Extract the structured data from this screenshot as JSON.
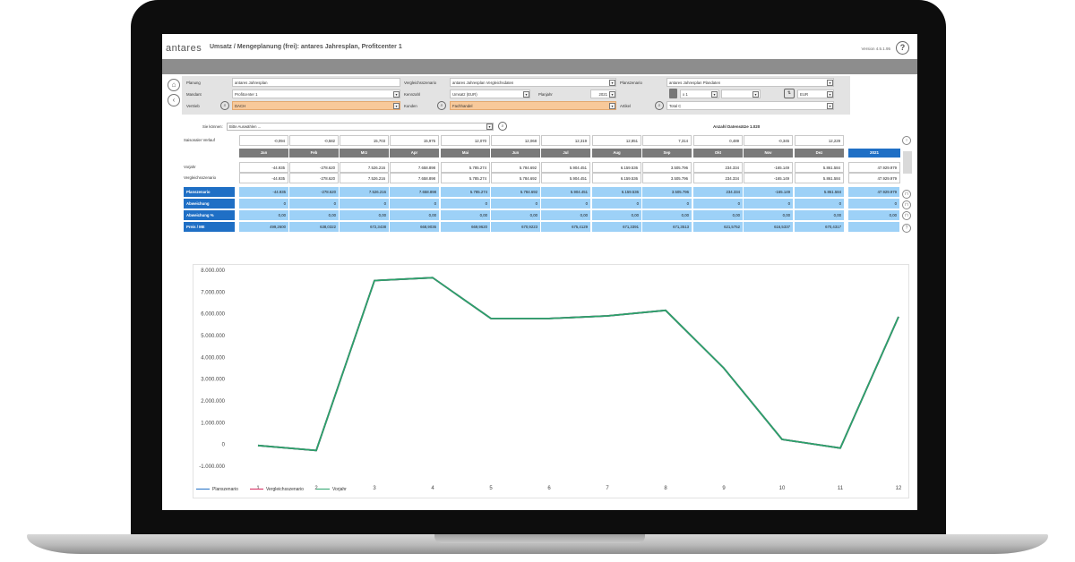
{
  "app": {
    "logo": "antares",
    "title": "Umsatz / Mengeplanung (frei): antares Jahresplan, Profitcenter 1",
    "version": "Version 4.5.1.95",
    "help": "?"
  },
  "filters": {
    "planung_label": "Planung",
    "planung_value": "antares Jahresplan",
    "mandant_label": "Mandant",
    "mandant_value": "Profitcenter 1",
    "vertrieb_label": "Vertrieb",
    "vertrieb_value": "DACH",
    "vergleich_label": "Vergleichsszenario",
    "vergleich_value": "antares Jahresplan Vergleichsdaten",
    "kennzahl_label": "Kennzahl",
    "kennzahl_value": "Umsatz (EUR)",
    "planjahr_label": "Planjahr",
    "planjahr_value": "2021",
    "kunden_label": "Kunden",
    "kunden_value": "Fachhandel",
    "planszenario_label": "Planszenario",
    "planszenario_value": "antares Jahresplan Plandaten",
    "factor_value": "x 1",
    "currency_value": "EUR",
    "artikel_label": "Artikel",
    "artikel_value": "Total C"
  },
  "grid": {
    "sie_koennen_label": "Sie können:",
    "sie_koennen_value": "Bitte Auswählen ...",
    "anzahl": "Anzahl Datensätze 1.020",
    "saison_label": "Saisonaler Verlauf",
    "saison": [
      "-0,094",
      "-0,582",
      "15,703",
      "15,975",
      "12,070",
      "12,068",
      "12,319",
      "12,851",
      "7,314",
      "0,489",
      "-0,345",
      "12,229"
    ],
    "months": [
      "Jan",
      "Feb",
      "Mrz",
      "Apr",
      "Mai",
      "Jun",
      "Jul",
      "Aug",
      "Sep",
      "Okt",
      "Nov",
      "Dez"
    ],
    "year": "2021",
    "rows": [
      {
        "label": "Vorjahr",
        "values": [
          "-44.935",
          "-278.620",
          "7.526.216",
          "7.658.898",
          "5.785.274",
          "5.784.692",
          "5.904.451",
          "6.159.536",
          "3.505.796",
          "234.334",
          "-165.149",
          "5.861.584"
        ],
        "total": "47.929.979"
      },
      {
        "label": "Vergleichsszenario",
        "values": [
          "-44.935",
          "-278.620",
          "7.526.216",
          "7.658.898",
          "5.785.274",
          "5.784.692",
          "5.904.451",
          "6.159.536",
          "3.505.796",
          "234.334",
          "-165.149",
          "5.861.584"
        ],
        "total": "47.929.979"
      }
    ],
    "blue_rows": [
      {
        "label": "Planszenario",
        "values": [
          "-44.935",
          "-278.620",
          "7.526.216",
          "7.658.898",
          "5.785.274",
          "5.784.692",
          "5.904.451",
          "6.159.536",
          "3.505.796",
          "234.334",
          "-165.149",
          "5.861.584"
        ],
        "total": "47.929.979"
      },
      {
        "label": "Abweichung",
        "values": [
          "0",
          "0",
          "0",
          "0",
          "0",
          "0",
          "0",
          "0",
          "0",
          "0",
          "0",
          "0"
        ],
        "total": "0"
      },
      {
        "label": "Abweichung %",
        "values": [
          "0,00",
          "0,00",
          "0,00",
          "0,00",
          "0,00",
          "0,00",
          "0,00",
          "0,00",
          "0,00",
          "0,00",
          "0,00",
          "0,00"
        ],
        "total": "0,00"
      },
      {
        "label": "Preis / ME",
        "values": [
          "499,2600",
          "638,0322",
          "672,3438",
          "668,9036",
          "669,9620",
          "670,9223",
          "675,4129",
          "671,3391",
          "671,3513",
          "621,5752",
          "616,5337",
          "670,4317"
        ],
        "total": ""
      }
    ]
  },
  "chart_data": {
    "type": "line",
    "x": [
      1,
      2,
      3,
      4,
      5,
      6,
      7,
      8,
      9,
      10,
      11,
      12
    ],
    "ylim": [
      -1000000,
      8000000
    ],
    "yticks": [
      "8.000.000",
      "7.000.000",
      "6.000.000",
      "5.000.000",
      "4.000.000",
      "3.000.000",
      "2.000.000",
      "1.000.000",
      "0",
      "-1.000.000"
    ],
    "xticks": [
      "1",
      "2",
      "3",
      "4",
      "5",
      "6",
      "7",
      "8",
      "9",
      "10",
      "11",
      "12"
    ],
    "series": [
      {
        "name": "Planszenario",
        "color": "#1f6fc5",
        "values": [
          -44935,
          -278620,
          7526216,
          7658898,
          5785274,
          5784692,
          5904451,
          6159536,
          3505796,
          234334,
          -165149,
          5861584
        ]
      },
      {
        "name": "Vergleichsszenario",
        "color": "#d6275c",
        "values": [
          -44935,
          -278620,
          7526216,
          7658898,
          5785274,
          5784692,
          5904451,
          6159536,
          3505796,
          234334,
          -165149,
          5861584
        ]
      },
      {
        "name": "Vorjahr",
        "color": "#2aa36b",
        "values": [
          -44935,
          -278620,
          7526216,
          7658898,
          5785274,
          5784692,
          5904451,
          6159536,
          3505796,
          234334,
          -165149,
          5861584
        ]
      }
    ],
    "grid": false,
    "legend": "bottom-left"
  }
}
